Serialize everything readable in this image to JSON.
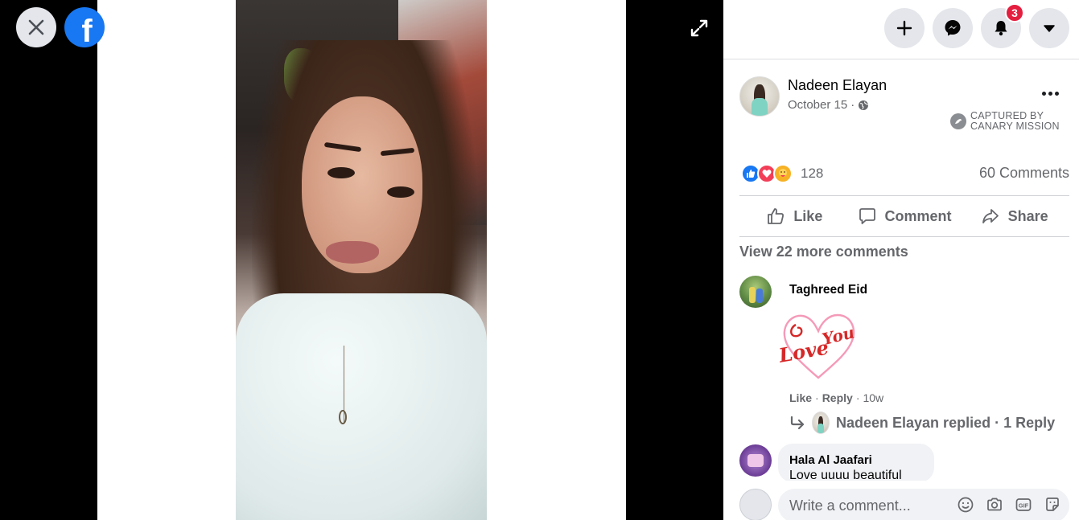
{
  "viewer": {
    "close_icon": "close-icon",
    "brand_letter": "f",
    "expand_icon": "expand-icon"
  },
  "topbar": {
    "create_icon": "plus-icon",
    "messenger_icon": "messenger-icon",
    "notifications_icon": "bell-icon",
    "notifications_count": "3",
    "account_icon": "caret-down-icon"
  },
  "post": {
    "author": "Nadeen Elayan",
    "date": "October 15",
    "separator": "·",
    "audience_icon": "globe-icon",
    "captured_line1": "CAPTURED BY",
    "captured_line2": "CANARY MISSION",
    "reaction_count": "128",
    "comments_count": "60 Comments",
    "actions": {
      "like": "Like",
      "comment": "Comment",
      "share": "Share"
    },
    "view_more": "View 22 more comments"
  },
  "comments": [
    {
      "author": "Taghreed Eid",
      "sticker_text_1": "Love",
      "sticker_text_2": "You",
      "like": "Like",
      "reply": "Reply",
      "time": "10w",
      "reply_summary": "Nadeen Elayan replied · 1 Reply"
    },
    {
      "author": "Hala Al Jaafari",
      "text": "Love uuuu beautiful"
    }
  ],
  "composer": {
    "placeholder": "Write a comment..."
  },
  "colors": {
    "brand": "#1877f2",
    "badge": "#e41e3f",
    "online": "#31a24c"
  }
}
